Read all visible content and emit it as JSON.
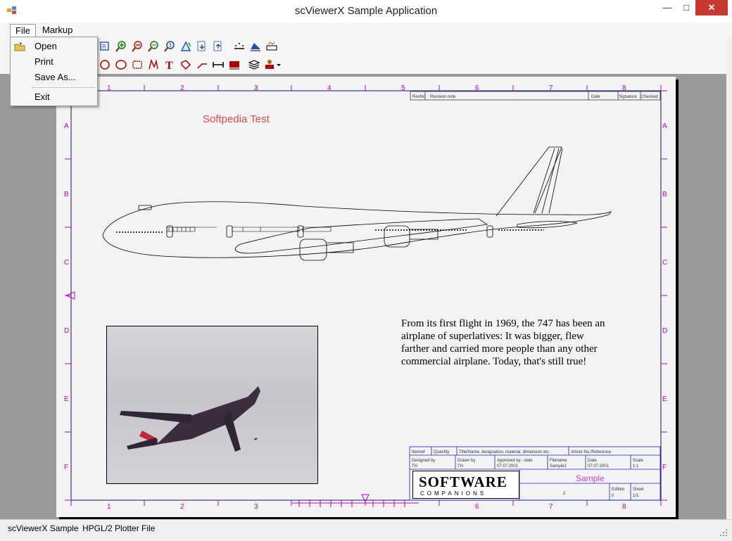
{
  "window": {
    "title": "scViewerX Sample Application",
    "controls": {
      "minimize": "—",
      "maximize": "□",
      "close": "✕"
    }
  },
  "menu": {
    "file": "File",
    "markup": "Markup",
    "file_items": {
      "open": "Open",
      "print": "Print",
      "save_as": "Save As...",
      "exit": "Exit"
    }
  },
  "toolbar_icons": {
    "row1": [
      "zoom-fit-icon",
      "zoom-in-icon",
      "zoom-out-icon",
      "zoom-window-icon",
      "zoom-extents-icon",
      "rotate-icon",
      "import-icon",
      "export-icon",
      "markup-pts-icon",
      "markup-area-icon",
      "markup-style-icon"
    ],
    "row2": [
      "circle-icon",
      "ellipse-icon",
      "cloud-icon",
      "polyline-icon",
      "text-icon",
      "eraser-icon",
      "arrow-icon",
      "dimension-icon",
      "stamp-icon",
      "layers-icon",
      "redline-icon"
    ]
  },
  "drawing": {
    "title": "Softpedia Test",
    "description": "From its first flight in 1969, the 747 has been an airplane of superlatives: It was bigger, flew farther and carried more people than any other commercial airplane. Today, that's still true!",
    "ruler_top": [
      "1",
      "2",
      "3",
      "4",
      "5",
      "6",
      "7",
      "8"
    ],
    "ruler_side": [
      "A",
      "B",
      "C",
      "D",
      "E",
      "F"
    ],
    "revision_header": [
      "RevNo",
      "Revision note",
      "Date",
      "Signature",
      "Checked"
    ],
    "title_block": {
      "row1": [
        "Itemref",
        "Quantity",
        "Title/Name, designation, material, dimension etc",
        "Article No./Reference"
      ],
      "row2_labels": [
        "Designed by",
        "Drawn by",
        "Approved by - date",
        "Filename",
        "Date",
        "Scale"
      ],
      "row2_values": [
        "TH",
        "TH",
        "07.07.2001",
        "Sample2",
        "07.07.2001",
        "1:1"
      ],
      "logo_main": "SOFTWARE",
      "logo_sub": "COMPANIONS",
      "sample_label": "Sample",
      "sheet_no": "2",
      "edition_label": "Edition",
      "edition": "0",
      "sheet_label": "Sheet",
      "sheet": "1/1"
    }
  },
  "status": {
    "app": "scViewerX Sample",
    "file": "HPGL/2 Plotter File"
  },
  "colors": {
    "accent_magenta": "#c000c0",
    "close_red": "#c7382f",
    "title_red": "#e64b4b"
  }
}
